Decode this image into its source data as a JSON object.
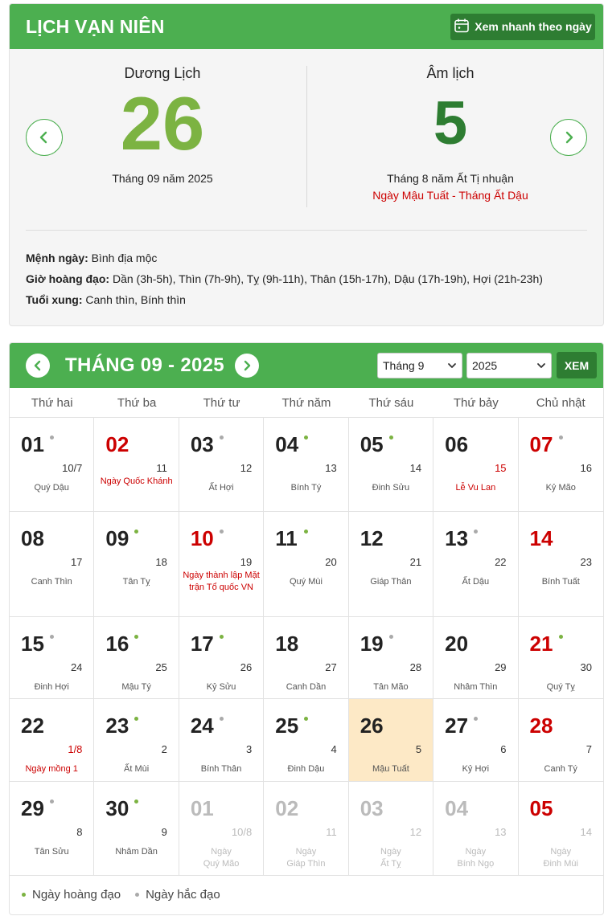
{
  "header": {
    "title": "LỊCH VẠN NIÊN",
    "quick_view_label": "Xem nhanh theo ngày"
  },
  "solar": {
    "label": "Dương Lịch",
    "day": "26",
    "month_year": "Tháng 09 năm 2025"
  },
  "lunar": {
    "label": "Âm lịch",
    "day": "5",
    "month_year": "Tháng 8 năm Ất Tị nhuận",
    "can_chi": "Ngày Mậu Tuất - Tháng Ất Dậu"
  },
  "info": {
    "menh_label": "Mệnh ngày:",
    "menh_value": "Bình địa mộc",
    "gio_label": "Giờ hoàng đạo:",
    "gio_value": "Dần (3h-5h), Thìn (7h-9h), Tỵ (9h-11h), Thân (15h-17h), Dậu (17h-19h), Hợi (21h-23h)",
    "tuoi_label": "Tuổi xung:",
    "tuoi_value": "Canh thìn, Bính thìn"
  },
  "calendar": {
    "title": "THÁNG 09 - 2025",
    "month_select": "Tháng 9",
    "year_select": "2025",
    "view_button": "XEM",
    "weekdays": [
      "Thứ hai",
      "Thứ ba",
      "Thứ tư",
      "Thứ năm",
      "Thứ sáu",
      "Thứ bảy",
      "Chủ nhật"
    ],
    "weeks": [
      [
        {
          "d": "01",
          "l": "10/7",
          "n": "Quý Dậu",
          "dot": "bad"
        },
        {
          "d": "02",
          "l": "11",
          "n": "",
          "ev": "Ngày Quốc Khánh",
          "red": true
        },
        {
          "d": "03",
          "l": "12",
          "n": "Ất Hợi",
          "dot": "bad"
        },
        {
          "d": "04",
          "l": "13",
          "n": "Bính Tý",
          "dot": "good"
        },
        {
          "d": "05",
          "l": "14",
          "n": "Đinh Sửu",
          "dot": "good"
        },
        {
          "d": "06",
          "l": "15",
          "n": "",
          "ev": "Lễ Vu Lan",
          "lred": true
        },
        {
          "d": "07",
          "l": "16",
          "n": "Kỷ Mão",
          "dot": "bad",
          "red": true
        }
      ],
      [
        {
          "d": "08",
          "l": "17",
          "n": "Canh Thìn"
        },
        {
          "d": "09",
          "l": "18",
          "n": "Tân Tỵ",
          "dot": "good"
        },
        {
          "d": "10",
          "l": "19",
          "n": "",
          "ev": "Ngày thành lập Mặt trận Tổ quốc VN",
          "dot": "bad",
          "red": true
        },
        {
          "d": "11",
          "l": "20",
          "n": "Quý Mùi",
          "dot": "good"
        },
        {
          "d": "12",
          "l": "21",
          "n": "Giáp Thân"
        },
        {
          "d": "13",
          "l": "22",
          "n": "Ất Dậu",
          "dot": "bad"
        },
        {
          "d": "14",
          "l": "23",
          "n": "Bính Tuất",
          "red": true
        }
      ],
      [
        {
          "d": "15",
          "l": "24",
          "n": "Đinh Hợi",
          "dot": "bad"
        },
        {
          "d": "16",
          "l": "25",
          "n": "Mậu Tý",
          "dot": "good"
        },
        {
          "d": "17",
          "l": "26",
          "n": "Kỷ Sửu",
          "dot": "good"
        },
        {
          "d": "18",
          "l": "27",
          "n": "Canh Dần"
        },
        {
          "d": "19",
          "l": "28",
          "n": "Tân Mão",
          "dot": "bad"
        },
        {
          "d": "20",
          "l": "29",
          "n": "Nhâm Thìn"
        },
        {
          "d": "21",
          "l": "30",
          "n": "Quý Tỵ",
          "dot": "good",
          "red": true
        }
      ],
      [
        {
          "d": "22",
          "l": "1/8",
          "n": "",
          "ev": "Ngày mồng 1",
          "lred": true
        },
        {
          "d": "23",
          "l": "2",
          "n": "Ất Mùi",
          "dot": "good"
        },
        {
          "d": "24",
          "l": "3",
          "n": "Bính Thân",
          "dot": "bad"
        },
        {
          "d": "25",
          "l": "4",
          "n": "Đinh Dậu",
          "dot": "good"
        },
        {
          "d": "26",
          "l": "5",
          "n": "Mậu Tuất",
          "today": true
        },
        {
          "d": "27",
          "l": "6",
          "n": "Kỷ Hợi",
          "dot": "bad"
        },
        {
          "d": "28",
          "l": "7",
          "n": "Canh Tý",
          "red": true
        }
      ],
      [
        {
          "d": "29",
          "l": "8",
          "n": "Tân Sửu",
          "dot": "bad"
        },
        {
          "d": "30",
          "l": "9",
          "n": "Nhâm Dần",
          "dot": "good"
        },
        {
          "d": "01",
          "l": "10/8",
          "n": "Ngày\nQuý Mão",
          "faded": true
        },
        {
          "d": "02",
          "l": "11",
          "n": "Ngày\nGiáp Thìn",
          "faded": true
        },
        {
          "d": "03",
          "l": "12",
          "n": "Ngày\nẤt Tỵ",
          "faded": true
        },
        {
          "d": "04",
          "l": "13",
          "n": "Ngày\nBính Ngọ",
          "faded": true
        },
        {
          "d": "05",
          "l": "14",
          "n": "Ngày\nĐinh Mùi",
          "faded": true,
          "red": true
        }
      ]
    ],
    "legend": {
      "good": "Ngày hoàng đạo",
      "bad": "Ngày hắc đạo"
    }
  },
  "colors": {
    "green": "#4caf50",
    "dark_green": "#2e7d32",
    "light_green": "#7cb342",
    "red": "#cc0000",
    "today_bg": "#fde9c6"
  }
}
